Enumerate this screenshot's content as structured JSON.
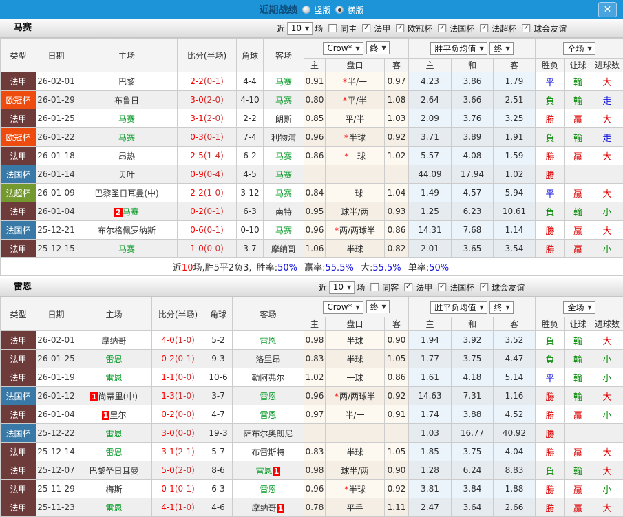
{
  "title_bar": {
    "title": "近期战绩",
    "layout_vertical": "竖版",
    "layout_horizontal": "横版",
    "selected_layout": "横版",
    "close_icon": "✕"
  },
  "table_header": {
    "type": "类型",
    "date": "日期",
    "home": "主场",
    "score": "比分(半场)",
    "corner": "角球",
    "away": "客场",
    "bookmaker_select": "Crow*",
    "final_select": "终",
    "avg_select": "胜平负均值",
    "final_select2": "终",
    "scope_select": "全场",
    "odds_home": "主",
    "odds_handicap": "盘口",
    "odds_away": "客",
    "avg_home": "主",
    "avg_draw": "和",
    "avg_away": "客",
    "result_wdl": "胜负",
    "result_handicap": "让球",
    "result_goals": "进球数"
  },
  "filter_labels": {
    "near": "近",
    "match_count": "10",
    "games": "场"
  },
  "comp_colors": {
    "法甲": "#6e3b3b",
    "欧冠杯": "#ee4b0e",
    "法国杯": "#3879a8",
    "法超杯": "#74992e"
  },
  "result_colors": {
    "勝": "#dd0000",
    "贏": "#dd0000",
    "大": "#dd0000",
    "負": "#008800",
    "輸": "#008800",
    "小": "#008800",
    "平": "#1414dd",
    "走": "#1414dd"
  },
  "sections": {
    "marseille": {
      "team": "马赛",
      "same_venue_label": "同主",
      "same_venue_checked": false,
      "leagues": [
        {
          "label": "法甲",
          "checked": true
        },
        {
          "label": "欧冠杯",
          "checked": true
        },
        {
          "label": "法国杯",
          "checked": true
        },
        {
          "label": "法超杯",
          "checked": true
        },
        {
          "label": "球会友谊",
          "checked": true
        }
      ],
      "rows": [
        {
          "comp": "法甲",
          "date": "26-02-01",
          "home": {
            "name": "巴黎"
          },
          "score": "2-2",
          "half": "(0-1)",
          "corners": "4-4",
          "away": {
            "name": "马赛",
            "focus": true
          },
          "odds": [
            "0.91",
            "*半/一",
            "0.97"
          ],
          "avg": [
            "4.23",
            "3.86",
            "1.79"
          ],
          "results": [
            "平",
            "輸",
            "大"
          ]
        },
        {
          "comp": "欧冠杯",
          "date": "26-01-29",
          "home": {
            "name": "布鲁日"
          },
          "score": "3-0",
          "half": "(2-0)",
          "corners": "4-10",
          "away": {
            "name": "马赛",
            "focus": true
          },
          "odds": [
            "0.80",
            "*平/半",
            "1.08"
          ],
          "avg": [
            "2.64",
            "3.66",
            "2.51"
          ],
          "results": [
            "負",
            "輸",
            "走"
          ]
        },
        {
          "comp": "法甲",
          "date": "26-01-25",
          "home": {
            "name": "马赛",
            "focus": true
          },
          "score": "3-1",
          "half": "(2-0)",
          "corners": "2-2",
          "away": {
            "name": "朗斯"
          },
          "odds": [
            "0.85",
            "平/半",
            "1.03"
          ],
          "avg": [
            "2.09",
            "3.76",
            "3.25"
          ],
          "results": [
            "勝",
            "贏",
            "大"
          ]
        },
        {
          "comp": "欧冠杯",
          "date": "26-01-22",
          "home": {
            "name": "马赛",
            "focus": true
          },
          "score": "0-3",
          "half": "(0-1)",
          "corners": "7-4",
          "away": {
            "name": "利物浦"
          },
          "odds": [
            "0.96",
            "*半球",
            "0.92"
          ],
          "avg": [
            "3.71",
            "3.89",
            "1.91"
          ],
          "results": [
            "負",
            "輸",
            "走"
          ]
        },
        {
          "comp": "法甲",
          "date": "26-01-18",
          "home": {
            "name": "昂热"
          },
          "score": "2-5",
          "half": "(1-4)",
          "corners": "6-2",
          "away": {
            "name": "马赛",
            "focus": true
          },
          "odds": [
            "0.86",
            "*一球",
            "1.02"
          ],
          "avg": [
            "5.57",
            "4.08",
            "1.59"
          ],
          "results": [
            "勝",
            "贏",
            "大"
          ]
        },
        {
          "comp": "法国杯",
          "date": "26-01-14",
          "home": {
            "name": "贝叶"
          },
          "score": "0-9",
          "half": "(0-4)",
          "corners": "4-5",
          "away": {
            "name": "马赛",
            "focus": true
          },
          "odds": [
            "",
            "",
            ""
          ],
          "avg": [
            "44.09",
            "17.94",
            "1.02"
          ],
          "results": [
            "勝",
            "",
            ""
          ]
        },
        {
          "comp": "法超杯",
          "date": "26-01-09",
          "home": {
            "name": "巴黎圣日耳曼(中)"
          },
          "score": "2-2",
          "half": "(1-0)",
          "corners": "3-12",
          "away": {
            "name": "马赛",
            "focus": true
          },
          "odds": [
            "0.84",
            "一球",
            "1.04"
          ],
          "avg": [
            "1.49",
            "4.57",
            "5.94"
          ],
          "results": [
            "平",
            "贏",
            "大"
          ]
        },
        {
          "comp": "法甲",
          "date": "26-01-04",
          "home": {
            "name": "马赛",
            "focus": true,
            "badge_before": "2"
          },
          "score": "0-2",
          "half": "(0-1)",
          "corners": "6-3",
          "away": {
            "name": "南特"
          },
          "odds": [
            "0.95",
            "球半/两",
            "0.93"
          ],
          "avg": [
            "1.25",
            "6.23",
            "10.61"
          ],
          "results": [
            "負",
            "輸",
            "小"
          ]
        },
        {
          "comp": "法国杯",
          "date": "25-12-21",
          "home": {
            "name": "布尔格佩罗纳斯"
          },
          "score": "0-6",
          "half": "(0-1)",
          "corners": "0-10",
          "away": {
            "name": "马赛",
            "focus": true
          },
          "odds": [
            "0.96",
            "*两/两球半",
            "0.86"
          ],
          "avg": [
            "14.31",
            "7.68",
            "1.14"
          ],
          "results": [
            "勝",
            "贏",
            "大"
          ]
        },
        {
          "comp": "法甲",
          "date": "25-12-15",
          "home": {
            "name": "马赛",
            "focus": true
          },
          "score": "1-0",
          "half": "(0-0)",
          "corners": "3-7",
          "away": {
            "name": "摩纳哥"
          },
          "odds": [
            "1.06",
            "半球",
            "0.82"
          ],
          "avg": [
            "2.01",
            "3.65",
            "3.54"
          ],
          "results": [
            "勝",
            "贏",
            "小"
          ]
        }
      ],
      "summary": {
        "lead": "近",
        "count": "10",
        "tail": "场,胜5平2负3,",
        "items": [
          {
            "label": "胜率:",
            "value": "50%"
          },
          {
            "label": "赢率:",
            "value": "55.5%"
          },
          {
            "label": "大:",
            "value": "55.5%"
          },
          {
            "label": "单率:",
            "value": "50%"
          }
        ]
      }
    },
    "rennes": {
      "team": "雷恩",
      "same_venue_label": "同客",
      "same_venue_checked": false,
      "leagues": [
        {
          "label": "法甲",
          "checked": true
        },
        {
          "label": "法国杯",
          "checked": true
        },
        {
          "label": "球会友谊",
          "checked": true
        }
      ],
      "rows": [
        {
          "comp": "法甲",
          "date": "26-02-01",
          "home": {
            "name": "摩纳哥"
          },
          "score": "4-0",
          "half": "(1-0)",
          "corners": "5-2",
          "away": {
            "name": "雷恩",
            "focus": true
          },
          "odds": [
            "0.98",
            "半球",
            "0.90"
          ],
          "avg": [
            "1.94",
            "3.92",
            "3.52"
          ],
          "results": [
            "負",
            "輸",
            "大"
          ]
        },
        {
          "comp": "法甲",
          "date": "26-01-25",
          "home": {
            "name": "雷恩",
            "focus": true
          },
          "score": "0-2",
          "half": "(0-1)",
          "corners": "9-3",
          "away": {
            "name": "洛里昂"
          },
          "odds": [
            "0.83",
            "半球",
            "1.05"
          ],
          "avg": [
            "1.77",
            "3.75",
            "4.47"
          ],
          "results": [
            "負",
            "輸",
            "小"
          ]
        },
        {
          "comp": "法甲",
          "date": "26-01-19",
          "home": {
            "name": "雷恩",
            "focus": true
          },
          "score": "1-1",
          "half": "(0-0)",
          "corners": "10-6",
          "away": {
            "name": "勒阿弗尔"
          },
          "odds": [
            "1.02",
            "一球",
            "0.86"
          ],
          "avg": [
            "1.61",
            "4.18",
            "5.14"
          ],
          "results": [
            "平",
            "輸",
            "小"
          ]
        },
        {
          "comp": "法国杯",
          "date": "26-01-12",
          "home": {
            "name": "尚蒂里(中)",
            "badge_before": "1"
          },
          "score": "1-3",
          "half": "(1-0)",
          "corners": "3-7",
          "away": {
            "name": "雷恩",
            "focus": true
          },
          "odds": [
            "0.96",
            "*两/两球半",
            "0.92"
          ],
          "avg": [
            "14.63",
            "7.31",
            "1.16"
          ],
          "results": [
            "勝",
            "輸",
            "大"
          ]
        },
        {
          "comp": "法甲",
          "date": "26-01-04",
          "home": {
            "name": "里尔",
            "badge_before": "1"
          },
          "score": "0-2",
          "half": "(0-0)",
          "corners": "4-7",
          "away": {
            "name": "雷恩",
            "focus": true
          },
          "odds": [
            "0.97",
            "半/一",
            "0.91"
          ],
          "avg": [
            "1.74",
            "3.88",
            "4.52"
          ],
          "results": [
            "勝",
            "贏",
            "小"
          ]
        },
        {
          "comp": "法国杯",
          "date": "25-12-22",
          "home": {
            "name": "雷恩",
            "focus": true
          },
          "score": "3-0",
          "half": "(0-0)",
          "corners": "19-3",
          "away": {
            "name": "萨布尔奥朗尼"
          },
          "odds": [
            "",
            "",
            ""
          ],
          "avg": [
            "1.03",
            "16.77",
            "40.92"
          ],
          "results": [
            "勝",
            "",
            ""
          ]
        },
        {
          "comp": "法甲",
          "date": "25-12-14",
          "home": {
            "name": "雷恩",
            "focus": true
          },
          "score": "3-1",
          "half": "(2-1)",
          "corners": "5-7",
          "away": {
            "name": "布雷斯特"
          },
          "odds": [
            "0.83",
            "半球",
            "1.05"
          ],
          "avg": [
            "1.85",
            "3.75",
            "4.04"
          ],
          "results": [
            "勝",
            "贏",
            "大"
          ]
        },
        {
          "comp": "法甲",
          "date": "25-12-07",
          "home": {
            "name": "巴黎圣日耳曼"
          },
          "score": "5-0",
          "half": "(2-0)",
          "corners": "8-6",
          "away": {
            "name": "雷恩",
            "focus": true,
            "badge_after": "1"
          },
          "odds": [
            "0.98",
            "球半/两",
            "0.90"
          ],
          "avg": [
            "1.28",
            "6.24",
            "8.83"
          ],
          "results": [
            "負",
            "輸",
            "大"
          ]
        },
        {
          "comp": "法甲",
          "date": "25-11-29",
          "home": {
            "name": "梅斯"
          },
          "score": "0-1",
          "half": "(0-1)",
          "corners": "6-3",
          "away": {
            "name": "雷恩",
            "focus": true
          },
          "odds": [
            "0.96",
            "*半球",
            "0.92"
          ],
          "avg": [
            "3.81",
            "3.84",
            "1.88"
          ],
          "results": [
            "勝",
            "贏",
            "小"
          ]
        },
        {
          "comp": "法甲",
          "date": "25-11-23",
          "home": {
            "name": "雷恩",
            "focus": true
          },
          "score": "4-1",
          "half": "(1-0)",
          "corners": "4-6",
          "away": {
            "name": "摩纳哥",
            "badge_after": "1"
          },
          "odds": [
            "0.78",
            "平手",
            "1.11"
          ],
          "avg": [
            "2.47",
            "3.64",
            "2.66"
          ],
          "results": [
            "勝",
            "贏",
            "大"
          ]
        }
      ]
    }
  }
}
